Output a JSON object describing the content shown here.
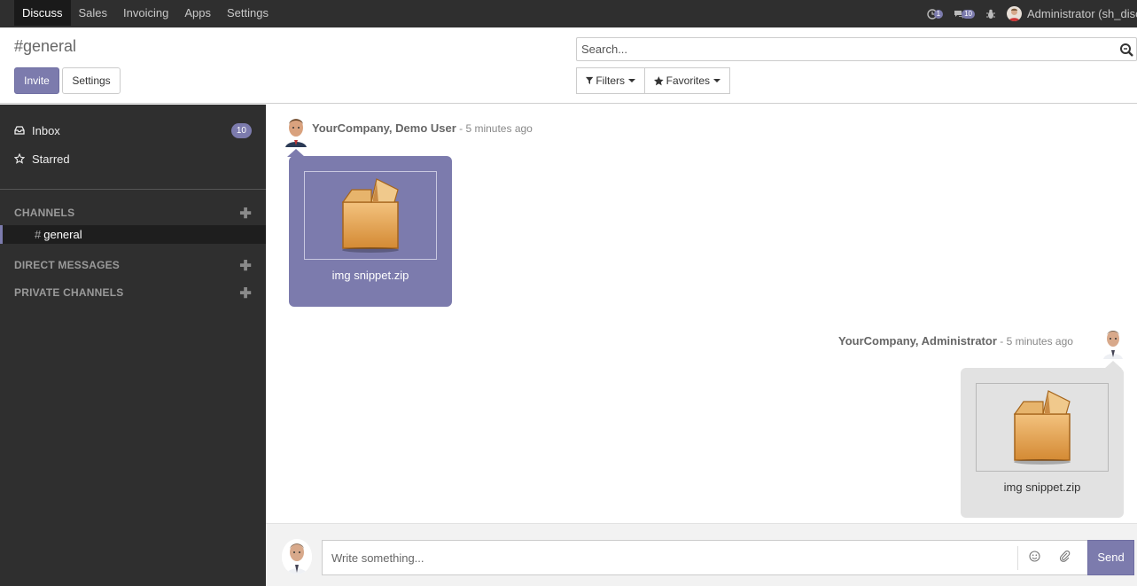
{
  "navbar": {
    "menu": [
      "Discuss",
      "Sales",
      "Invoicing",
      "Apps",
      "Settings"
    ],
    "activity_count": "1",
    "messages_count": "10",
    "user_label": "Administrator (sh_discu..."
  },
  "control_panel": {
    "title": "#general",
    "invite_label": "Invite",
    "settings_label": "Settings",
    "search_placeholder": "Search...",
    "filters_label": "Filters",
    "favorites_label": "Favorites"
  },
  "sidebar": {
    "inbox_label": "Inbox",
    "inbox_count": "10",
    "starred_label": "Starred",
    "channels_header": "CHANNELS",
    "channel_hash": "#",
    "active_channel": "general",
    "direct_messages_header": "DIRECT MESSAGES",
    "private_channels_header": "PRIVATE CHANNELS"
  },
  "messages": [
    {
      "author": "YourCompany, Demo User",
      "sep": " - ",
      "date": "5 minutes ago",
      "attachment": "img snippet.zip"
    },
    {
      "author": "YourCompany, Administrator",
      "sep": " - ",
      "date": "5 minutes ago",
      "attachment": "img snippet.zip"
    }
  ],
  "composer": {
    "placeholder": "Write something...",
    "send_label": "Send"
  },
  "colors": {
    "accent": "#7c7bad",
    "navbar": "#2f2f2f",
    "sidebar": "#2f2f2f"
  }
}
